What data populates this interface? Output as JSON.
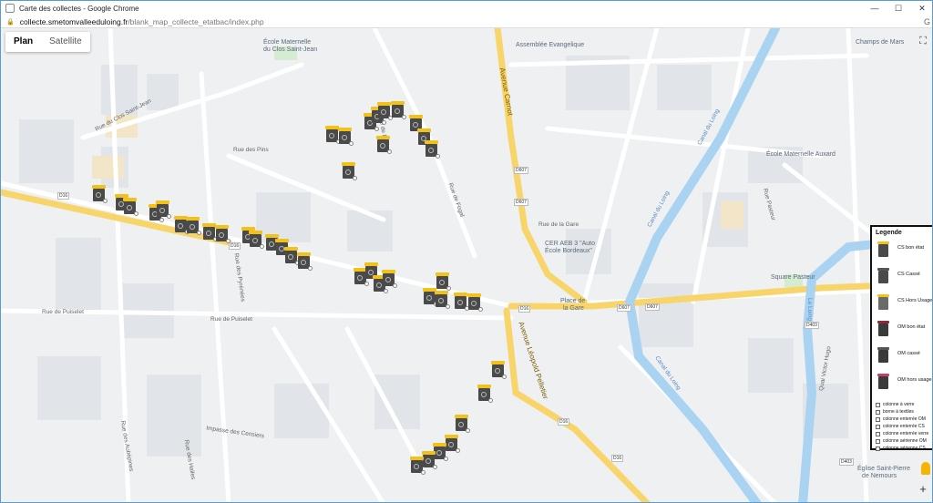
{
  "window": {
    "title": "Carte des collectes - Google Chrome"
  },
  "address": {
    "domain": "collecte.smetomvalleeduloing.fr",
    "path": "/blank_map_collecte_etatbac/index.php"
  },
  "map_type": {
    "options": [
      "Plan",
      "Satellite"
    ],
    "selected": "Plan"
  },
  "colors": {
    "road_major": "#f8d56b",
    "water": "#aad3f2",
    "bin_lid_cs": "#f2c21b",
    "bin_body": "#4a4a4a",
    "bin_lid_om": "#8b2c3c"
  },
  "labels": {
    "ecole_clos": "École Maternelle",
    "ecole_clos2": "du Clos Saint-Jean",
    "assemblee": "Assemblée Evangelique",
    "champs_mars": "Champs de Mars",
    "ecole_auxard": "École Maternelle Auxard",
    "cer": "CER AEB 3 \"Auto",
    "cer2": "École Bordeaux\"",
    "place_gare": "Place de",
    "place_gare2": "la Gare",
    "square": "Square Pasteur",
    "eglise": "Église Saint-Pierre",
    "eglise2": "de Nemours",
    "canal": "Canal du Loing",
    "canal2": "Canal du Loing",
    "canal3": "Canal du Loing",
    "le_loing": "Le Loing",
    "av_carnot": "Avenue Carnot",
    "av_leopold": "Avenue Léopold Pelletier",
    "rue_fosse": "Rue du Clos Saint-Jean",
    "rue_puiselet": "Rue de Puiselet",
    "rue_puiselet2": "Rue de Puiselet",
    "rue_pins": "Rue des Pins",
    "rue_fogal": "Rue de Fogal",
    "rue_gare": "Rue de la Gare",
    "quai_hugo": "Quai Victor Hugo",
    "rue_pyrenees": "Rue des Pyrénées",
    "impasse_cerisiers": "Impasse des Cerisiers",
    "rue_halles": "Rue des Halles",
    "rue_aubepines": "Rue des Aubépines",
    "rue_pasteur": "Rue Pasteur",
    "rue_victor": "Rue de Fogal"
  },
  "shields": [
    "D16",
    "D16",
    "D607",
    "D607",
    "D607",
    "D607",
    "D403",
    "D403",
    "D16",
    "D16",
    "D16"
  ],
  "legend": {
    "title": "Legende",
    "items": [
      {
        "label": "CS bon état",
        "lid": "#f2c21b",
        "body": "#4a4a4a"
      },
      {
        "label": "CS Cassé",
        "lid": "#555555",
        "body": "#4a4a4a"
      },
      {
        "label": "CS Hors Usage",
        "lid": "#f2c21b",
        "body": "#6a6a6a"
      },
      {
        "label": "OM bon état",
        "lid": "#8b2c3c",
        "body": "#3a3a3a"
      },
      {
        "label": "OM cassé",
        "lid": "#555555",
        "body": "#3a3a3a"
      },
      {
        "label": "OM hors usage",
        "lid": "#c0406a",
        "body": "#3a3a3a"
      }
    ],
    "checkboxes": [
      "colonne à verre",
      "borne à textiles",
      "colonne enterrée OM",
      "colonne enterrée CS",
      "colonne enterrée verre",
      "colonne aérienne OM",
      "colonne aérienne CS"
    ]
  }
}
